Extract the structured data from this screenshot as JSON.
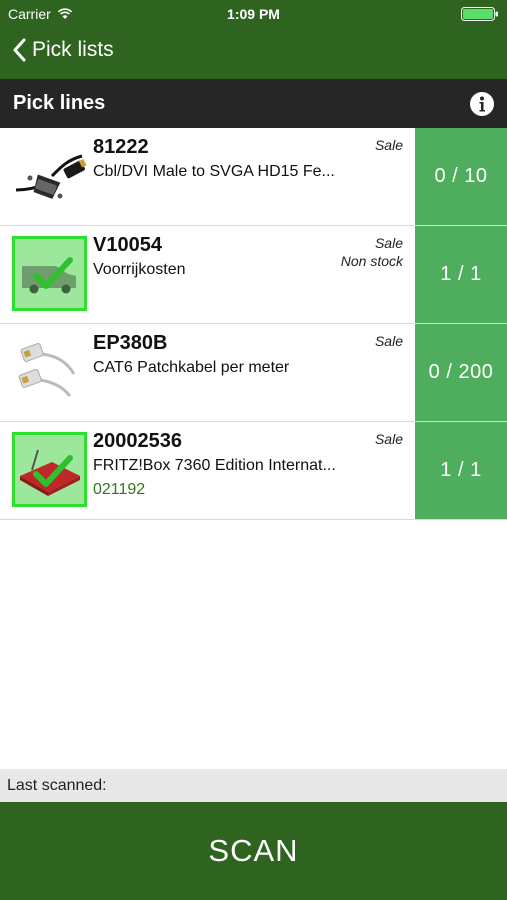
{
  "status_bar": {
    "carrier": "Carrier",
    "time": "1:09 PM"
  },
  "nav": {
    "back_label": "Pick lists"
  },
  "section": {
    "title": "Pick lines"
  },
  "colors": {
    "nav_green": "#2e6420",
    "qty_green": "#4fae5e",
    "header_dark": "#262626",
    "check_green": "#33dd33"
  },
  "items": [
    {
      "code": "81222",
      "description": "Cbl/DVI Male to SVGA HD15 Fe...",
      "tag": "Sale",
      "tag2": "",
      "sub": "",
      "quantity": "0 / 10",
      "icon": "cable-icon"
    },
    {
      "code": "V10054",
      "description": "Voorrijkosten",
      "tag": "Sale",
      "tag2": "Non stock",
      "sub": "",
      "quantity": "1 / 1",
      "icon": "van-icon"
    },
    {
      "code": "EP380B",
      "description": "CAT6 Patchkabel per meter",
      "tag": "Sale",
      "tag2": "",
      "sub": "",
      "quantity": "0 / 200",
      "icon": "patch-cable-icon"
    },
    {
      "code": "20002536",
      "description": "FRITZ!Box 7360 Edition Internat...",
      "tag": "Sale",
      "tag2": "",
      "sub": "021192",
      "quantity": "1 / 1",
      "icon": "router-icon"
    }
  ],
  "footer": {
    "last_scanned_label": "Last scanned:",
    "scan_button": "SCAN"
  }
}
